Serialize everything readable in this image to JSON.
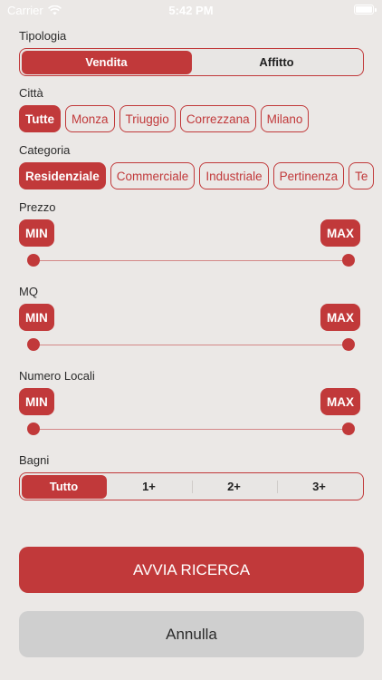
{
  "status_bar": {
    "carrier": "Carrier",
    "time": "5:42 PM"
  },
  "tipologia": {
    "label": "Tipologia",
    "options": [
      "Vendita",
      "Affitto"
    ],
    "selected": "Vendita"
  },
  "citta": {
    "label": "Città",
    "options": [
      "Tutte",
      "Monza",
      "Triuggio",
      "Correzzana",
      "Milano"
    ],
    "selected": "Tutte"
  },
  "categoria": {
    "label": "Categoria",
    "options": [
      "Residenziale",
      "Commerciale",
      "Industriale",
      "Pertinenza",
      "Te"
    ],
    "selected": "Residenziale"
  },
  "prezzo": {
    "label": "Prezzo",
    "min_label": "MIN",
    "max_label": "MAX"
  },
  "mq": {
    "label": "MQ",
    "min_label": "MIN",
    "max_label": "MAX"
  },
  "numero_locali": {
    "label": "Numero Locali",
    "min_label": "MIN",
    "max_label": "MAX"
  },
  "bagni": {
    "label": "Bagni",
    "options": [
      "Tutto",
      "1+",
      "2+",
      "3+"
    ],
    "selected": "Tutto"
  },
  "actions": {
    "search_label": "AVVIA RICERCA",
    "cancel_label": "Annulla"
  },
  "colors": {
    "accent": "#c1393a",
    "background": "#ebe8e6",
    "secondary_button": "#cfcfcf"
  }
}
